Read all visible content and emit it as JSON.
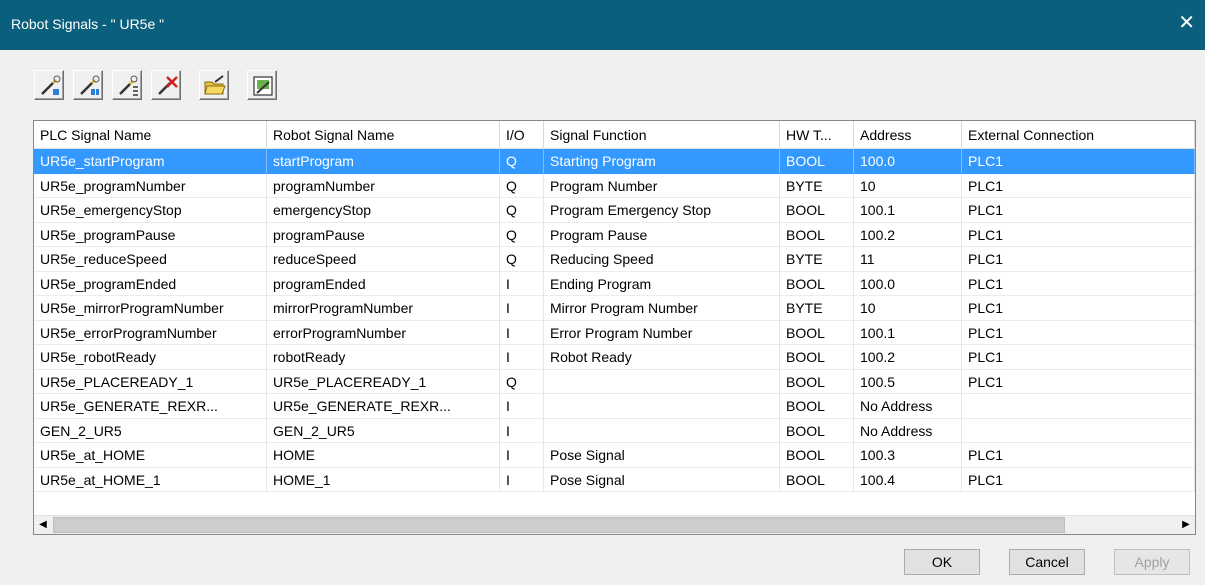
{
  "window": {
    "title": "Robot Signals - \" UR5e \"",
    "close_glyph": "✕"
  },
  "toolbar": {
    "buttons": [
      {
        "icon": "add-signal-wand-icon"
      },
      {
        "icon": "add-signal-wand-alt-icon"
      },
      {
        "icon": "add-signal-list-icon"
      },
      {
        "icon": "delete-signal-icon"
      },
      {
        "icon": "open-folder-icon"
      },
      {
        "icon": "export-signals-icon"
      }
    ]
  },
  "table": {
    "columns": [
      "PLC Signal Name",
      "Robot Signal Name",
      "I/O",
      "Signal Function",
      "HW T...",
      "Address",
      "External Connection"
    ],
    "selected_row": 0,
    "rows": [
      [
        "UR5e_startProgram",
        "startProgram",
        "Q",
        "Starting Program",
        "BOOL",
        "100.0",
        "PLC1"
      ],
      [
        "UR5e_programNumber",
        "programNumber",
        "Q",
        "Program Number",
        "BYTE",
        "10",
        "PLC1"
      ],
      [
        "UR5e_emergencyStop",
        "emergencyStop",
        "Q",
        "Program Emergency Stop",
        "BOOL",
        "100.1",
        "PLC1"
      ],
      [
        "UR5e_programPause",
        "programPause",
        "Q",
        "Program Pause",
        "BOOL",
        "100.2",
        "PLC1"
      ],
      [
        "UR5e_reduceSpeed",
        "reduceSpeed",
        "Q",
        "Reducing Speed",
        "BYTE",
        "11",
        "PLC1"
      ],
      [
        "UR5e_programEnded",
        "programEnded",
        "I",
        "Ending Program",
        "BOOL",
        "100.0",
        "PLC1"
      ],
      [
        "UR5e_mirrorProgramNumber",
        "mirrorProgramNumber",
        "I",
        "Mirror Program Number",
        "BYTE",
        "10",
        "PLC1"
      ],
      [
        "UR5e_errorProgramNumber",
        "errorProgramNumber",
        "I",
        "Error Program Number",
        "BOOL",
        "100.1",
        "PLC1"
      ],
      [
        "UR5e_robotReady",
        "robotReady",
        "I",
        "Robot Ready",
        "BOOL",
        "100.2",
        "PLC1"
      ],
      [
        "UR5e_PLACEREADY_1",
        "UR5e_PLACEREADY_1",
        "Q",
        "",
        "BOOL",
        "100.5",
        "PLC1"
      ],
      [
        "UR5e_GENERATE_REXR...",
        "UR5e_GENERATE_REXR...",
        "I",
        "",
        "BOOL",
        "No Address",
        ""
      ],
      [
        "GEN_2_UR5",
        "GEN_2_UR5",
        "I",
        "",
        "BOOL",
        "No Address",
        ""
      ],
      [
        "UR5e_at_HOME",
        "HOME",
        "I",
        "Pose Signal",
        "BOOL",
        "100.3",
        "PLC1"
      ],
      [
        "UR5e_at_HOME_1",
        "HOME_1",
        "I",
        "Pose Signal",
        "BOOL",
        "100.4",
        "PLC1"
      ]
    ]
  },
  "scrollbar": {
    "left_glyph": "◀",
    "right_glyph": "▶"
  },
  "buttons": {
    "ok": "OK",
    "cancel": "Cancel",
    "apply": "Apply"
  }
}
